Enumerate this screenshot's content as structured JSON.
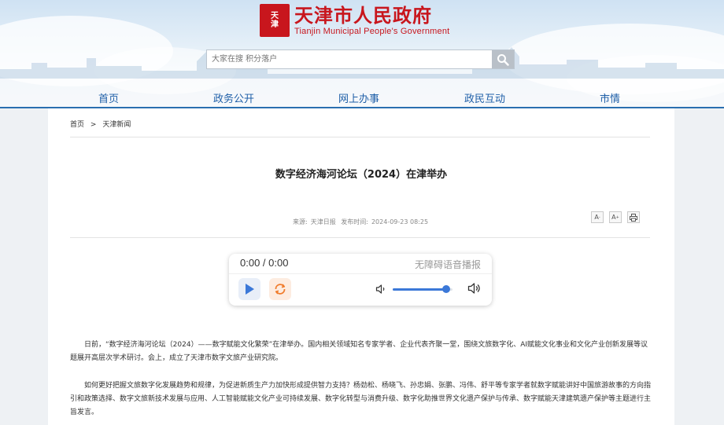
{
  "header": {
    "seal_lines": [
      "天",
      "津"
    ],
    "logo_cn": "天津市人民政府",
    "logo_en": "Tianjin Municipal People's Government",
    "search_placeholder": "大家在搜 积分落户"
  },
  "nav": {
    "items": [
      {
        "label": "首页"
      },
      {
        "label": "政务公开"
      },
      {
        "label": "网上办事"
      },
      {
        "label": "政民互动"
      },
      {
        "label": "市情"
      }
    ]
  },
  "breadcrumb": {
    "home": "首页",
    "separator": ">",
    "current": "天津新闻"
  },
  "article": {
    "title": "数字经济海河论坛（2024）在津举办",
    "source_label": "来源:",
    "source": "天津日报",
    "date_label": "发布时间:",
    "date": "2024-09-23 08:25",
    "paragraphs": [
      "日前，“数字经济海河论坛（2024）——数字赋能文化繁荣”在津举办。国内相关领域知名专家学者、企业代表齐聚一堂，围绕文旅数字化、AI赋能文化事业和文化产业创新发展等议题展开高层次学术研讨。会上，成立了天津市数字文旅产业研究院。",
      "如何更好把握文旅数字化发展趋势和规律，为促进新质生产力加快形成提供智力支持？杨劲松、杨晓飞、孙忠娟、张鹏、冯伟、舒平等专家学者就数字赋能讲好中国旅游故事的方向指引和政策选择、数字文旅新技术发展与应用、人工智能赋能文化产业可持续发展、数字化转型与消费升级、数字化助推世界文化遗产保护与传承、数字赋能天津建筑遗产保护等主题进行主旨发言。"
    ]
  },
  "tools": {
    "font_smaller": "A",
    "font_larger": "A"
  },
  "player": {
    "time": "0:00 / 0:00",
    "tts_label": "无障碍语音播报",
    "volume": 0.9,
    "accent": "#3b78d8",
    "loop_color": "#f07c2c"
  }
}
